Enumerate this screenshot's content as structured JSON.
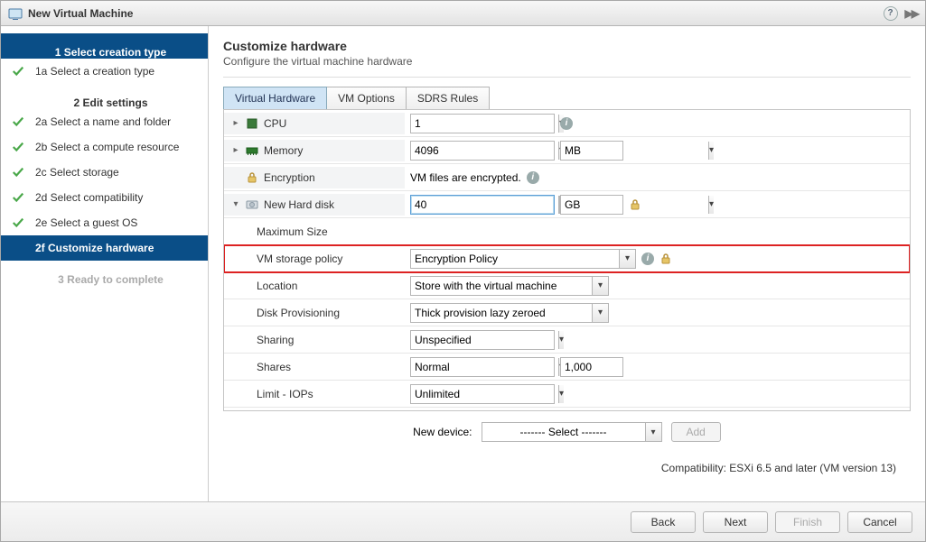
{
  "titlebar": {
    "title": "New Virtual Machine"
  },
  "sidebar": {
    "s1": "1  Select creation type",
    "s1a": "1a Select a creation type",
    "s2": "2  Edit settings",
    "s2a": "2a Select a name and folder",
    "s2b": "2b Select a compute resource",
    "s2c": "2c Select storage",
    "s2d": "2d Select compatibility",
    "s2e": "2e Select a guest OS",
    "s2f": "2f  Customize hardware",
    "s3": "3  Ready to complete"
  },
  "main": {
    "heading": "Customize hardware",
    "subheading": "Configure the virtual machine hardware",
    "tabs": {
      "t1": "Virtual Hardware",
      "t2": "VM Options",
      "t3": "SDRS Rules"
    },
    "rows": {
      "cpu_label": "CPU",
      "cpu_value": "1",
      "memory_label": "Memory",
      "memory_value": "4096",
      "memory_unit": "MB",
      "encryption_label": "Encryption",
      "encryption_value": "VM files are encrypted.",
      "newdisk_label": "New Hard disk",
      "newdisk_value": "40",
      "newdisk_unit": "GB",
      "maxsize_label": "Maximum Size",
      "policy_label": "VM storage policy",
      "policy_value": "Encryption Policy",
      "location_label": "Location",
      "location_value": "Store with the virtual machine",
      "provisioning_label": "Disk Provisioning",
      "provisioning_value": "Thick provision lazy zeroed",
      "sharing_label": "Sharing",
      "sharing_value": "Unspecified",
      "shares_label": "Shares",
      "shares_value": "Normal",
      "shares_num": "1,000",
      "limit_label": "Limit - IOPs",
      "limit_value": "Unlimited"
    },
    "newdevice_label": "New device:",
    "newdevice_value": "------- Select -------",
    "newdevice_add": "Add",
    "compat": "Compatibility: ESXi 6.5 and later (VM version 13)"
  },
  "footer": {
    "back": "Back",
    "next": "Next",
    "finish": "Finish",
    "cancel": "Cancel"
  }
}
